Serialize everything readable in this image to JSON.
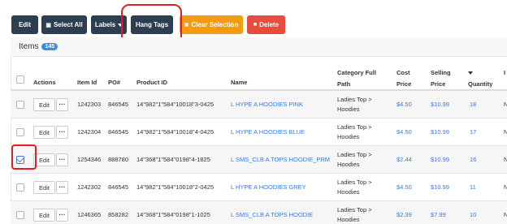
{
  "toolbar": {
    "edit": "Edit",
    "select_all": "Select All",
    "labels": "Labels",
    "hang_tags": "Hang Tags",
    "clear_selection": "Clear Selection",
    "delete": "Delete"
  },
  "items": {
    "title": "Items",
    "count": "145"
  },
  "columns": {
    "actions": "Actions",
    "item_id": "Item Id",
    "po": "PO#",
    "product_id": "Product ID",
    "name": "Name",
    "category_line1": "Category Full",
    "category_line2": "Path",
    "cost_line1": "Cost",
    "cost_line2": "Price",
    "selling_line1": "Selling",
    "selling_line2": "Price",
    "quantity": "Quantity",
    "last_col": "I"
  },
  "row_actions": {
    "edit": "Edit",
    "more": "···"
  },
  "rows": [
    {
      "item_id": "1242303",
      "po": "846545",
      "product_id": "14\"982\"1\"584\"10018\"3-0425",
      "name": "L HYPE A HOODIES PINK",
      "category_line1": "Ladies Top >",
      "category_line2": "Hoodies",
      "cost": "$4.50",
      "selling": "$10.99",
      "quantity": "18",
      "last": "N",
      "checked": false
    },
    {
      "item_id": "1242304",
      "po": "846545",
      "product_id": "14\"982\"1\"584\"10018\"4-0425",
      "name": "L HYPE A HOODIES BLUE",
      "category_line1": "Ladies Top >",
      "category_line2": "Hoodies",
      "cost": "$4.50",
      "selling": "$10.99",
      "quantity": "17",
      "last": "N",
      "checked": false
    },
    {
      "item_id": "1254346",
      "po": "888780",
      "product_id": "14\"368\"1\"584\"0198\"4-1825",
      "name": "L SMS_CLB A TOPS HOODIE_PRM",
      "category_line1": "Ladies Top >",
      "category_line2": "Hoodies",
      "cost": "$2.44",
      "selling": "$10.99",
      "quantity": "16",
      "last": "N",
      "checked": true
    },
    {
      "item_id": "1242302",
      "po": "846545",
      "product_id": "14\"982\"1\"584\"10018\"2-0425",
      "name": "L HYPE A HOODIES GREY",
      "category_line1": "Ladies Top >",
      "category_line2": "Hoodies",
      "cost": "$4.50",
      "selling": "$10.99",
      "quantity": "11",
      "last": "N",
      "checked": false
    },
    {
      "item_id": "1246365",
      "po": "858282",
      "product_id": "14\"368\"1\"584\"0198\"1-1025",
      "name": "L SMS_CLB A TOPS HOODIE",
      "category_line1": "Ladies Top >",
      "category_line2": "Hoodies",
      "cost": "$2.39",
      "selling": "$7.99",
      "quantity": "10",
      "last": "N",
      "checked": false
    }
  ]
}
